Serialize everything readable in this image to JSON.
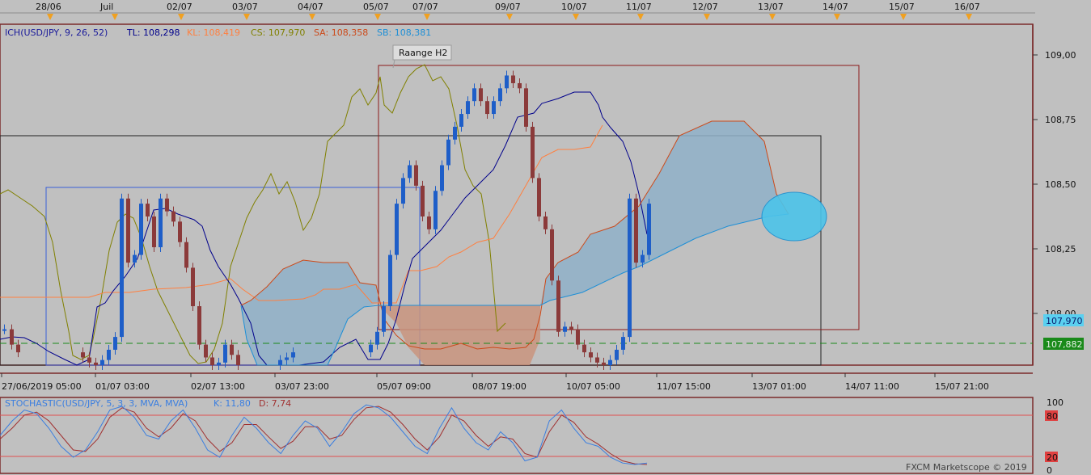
{
  "header": {
    "dates": [
      "28/06",
      "Juil",
      "02/07",
      "03/07",
      "04/07",
      "05/07",
      "07/07",
      "09/07",
      "10/07",
      "11/07",
      "12/07",
      "13/07",
      "14/07",
      "15/07",
      "16/07"
    ]
  },
  "legend_main": {
    "ich": "ICH(USD/JPY, 9, 26, 52)",
    "tl": "TL: 108,298",
    "kl": "KL: 108,419",
    "cs": "CS: 107,970",
    "sa": "SA: 108,358",
    "sb": "SB: 108,381"
  },
  "annotation": {
    "label": "Raange H2"
  },
  "price_axis": {
    "ticks": [
      "109,00",
      "108,75",
      "108,50",
      "108,25",
      "108,00"
    ],
    "current_price": "107,970",
    "level_price": "107,882"
  },
  "time_axis": {
    "labels": [
      "27/06/2019 05:00",
      "01/07 03:00",
      "02/07 13:00",
      "03/07 23:00",
      "05/07 09:00",
      "08/07 19:00",
      "10/07 05:00",
      "11/07 15:00",
      "13/07 01:00",
      "14/07 11:00",
      "15/07 21:00"
    ]
  },
  "stochastic": {
    "legend": "STOCHASTIC(USD/JPY, 5, 3, 3, MVA, MVA)",
    "k": "K: 11,80",
    "d": "D: 7,74",
    "ticks": [
      "100",
      "80",
      "20",
      "0"
    ],
    "watermark": "FXCM Marketscope © 2019"
  },
  "colors": {
    "bull": "#1e5ec8",
    "bear": "#8b3a3a",
    "tenkan": "#00008b",
    "kijun": "#ff7f3f",
    "chikou": "#808000",
    "senkouA": "#cc4a1a",
    "senkouB": "#1e8fd6",
    "kumo_bull": "#8fb0c8",
    "kumo_bear": "#c9947e",
    "stoch_k": "#3a7ee0",
    "stoch_d": "#a03030"
  },
  "chart_data": {
    "type": "line",
    "title": "",
    "instrument": "USD/JPY",
    "ylim": [
      107.82,
      109.15
    ],
    "y_ticks": [
      108.0,
      108.25,
      108.5,
      108.75,
      109.0
    ],
    "grid": false,
    "ichimoku_last": {
      "tenkan": 108.298,
      "kijun": 108.419,
      "chikou": 107.97,
      "senkou_a": 108.358,
      "senkou_b": 108.381
    },
    "price_close": [
      107.96,
      107.9,
      107.87,
      107.85,
      107.83,
      107.82,
      107.84,
      107.88,
      107.93,
      108.47,
      108.22,
      108.25,
      108.45,
      108.4,
      108.28,
      108.47,
      108.42,
      108.38,
      108.3,
      108.2,
      108.05,
      107.9,
      107.85,
      107.82,
      107.83,
      107.9,
      107.86,
      107.82,
      107.84,
      107.85,
      107.87,
      107.9,
      107.95,
      108.05,
      108.25,
      108.45,
      108.55,
      108.6,
      108.52,
      108.4,
      108.35,
      108.5,
      108.6,
      108.7,
      108.75,
      108.8,
      108.85,
      108.9,
      108.85,
      108.8,
      108.85,
      108.9,
      108.95,
      108.92,
      108.9,
      108.75,
      108.55,
      108.4,
      108.35,
      108.15,
      107.95,
      107.97
    ],
    "senkou_a": [
      108.05,
      108.15,
      108.2,
      108.05,
      107.95,
      108.0,
      108.1,
      108.2,
      108.35,
      108.55,
      108.72,
      108.74,
      108.72,
      108.38
    ],
    "senkou_b": [
      108.05,
      107.97,
      107.95,
      107.9,
      107.9,
      108.03,
      108.1,
      108.12,
      108.15,
      108.22,
      108.27,
      108.32,
      108.38,
      108.38
    ],
    "stochastic": {
      "k_last": 11.8,
      "d_last": 7.74,
      "levels": [
        20,
        80
      ],
      "k": [
        50,
        70,
        85,
        80,
        60,
        35,
        20,
        30,
        55,
        85,
        90,
        75,
        50,
        45,
        70,
        85,
        60,
        30,
        20,
        50,
        75,
        60,
        40,
        25,
        50,
        70,
        60,
        35,
        55,
        80,
        92,
        88,
        75,
        55,
        35,
        25,
        60,
        88,
        60,
        40,
        30,
        55,
        40,
        15,
        20,
        70,
        85,
        60,
        40,
        35,
        20,
        12,
        10,
        12
      ],
      "d": [
        45,
        60,
        78,
        82,
        70,
        50,
        30,
        28,
        45,
        75,
        88,
        82,
        60,
        48,
        60,
        80,
        70,
        45,
        28,
        40,
        65,
        65,
        48,
        32,
        42,
        62,
        62,
        45,
        50,
        72,
        88,
        90,
        82,
        65,
        45,
        30,
        48,
        78,
        70,
        50,
        35,
        48,
        45,
        25,
        20,
        55,
        78,
        68,
        48,
        38,
        25,
        15,
        11,
        10
      ]
    }
  }
}
